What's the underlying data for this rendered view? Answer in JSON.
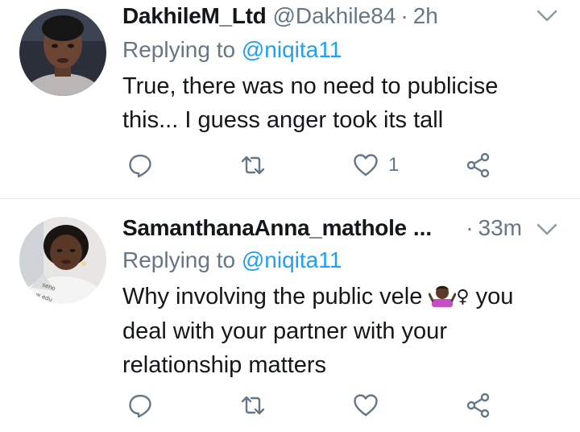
{
  "tweets": [
    {
      "name": "DakhileM_Ltd",
      "handle": "@Dakhile84",
      "separator": "·",
      "time": "2h",
      "replying_prefix": "Replying to ",
      "replying_handle": "@niqita11",
      "text_line_1": "True, there was no need to publicise",
      "text_line_2": "this... I guess anger took its tall",
      "like_count": "1",
      "icons": [
        "reply-icon",
        "retweet-icon",
        "heart-icon",
        "share-icon",
        "chevron-down-icon"
      ]
    },
    {
      "name": "SamanthanaAnna_mathole",
      "ellipsis": "...",
      "separator": "·",
      "time": "33m",
      "replying_prefix": "Replying to ",
      "replying_handle": "@niqita11",
      "text_before_emoji": "Why involving the public vele ",
      "emoji": "🤷🏾‍♀️",
      "text_after_emoji": " you",
      "text_line_2": "deal with your partner with your",
      "text_line_3": "relationship matters",
      "icons": [
        "reply-icon",
        "retweet-icon",
        "heart-icon",
        "share-icon",
        "chevron-down-icon"
      ]
    }
  ],
  "colors": {
    "text": "#14171a",
    "secondary": "#657786",
    "link": "#1da1f2",
    "divider": "#e1e8ed"
  }
}
